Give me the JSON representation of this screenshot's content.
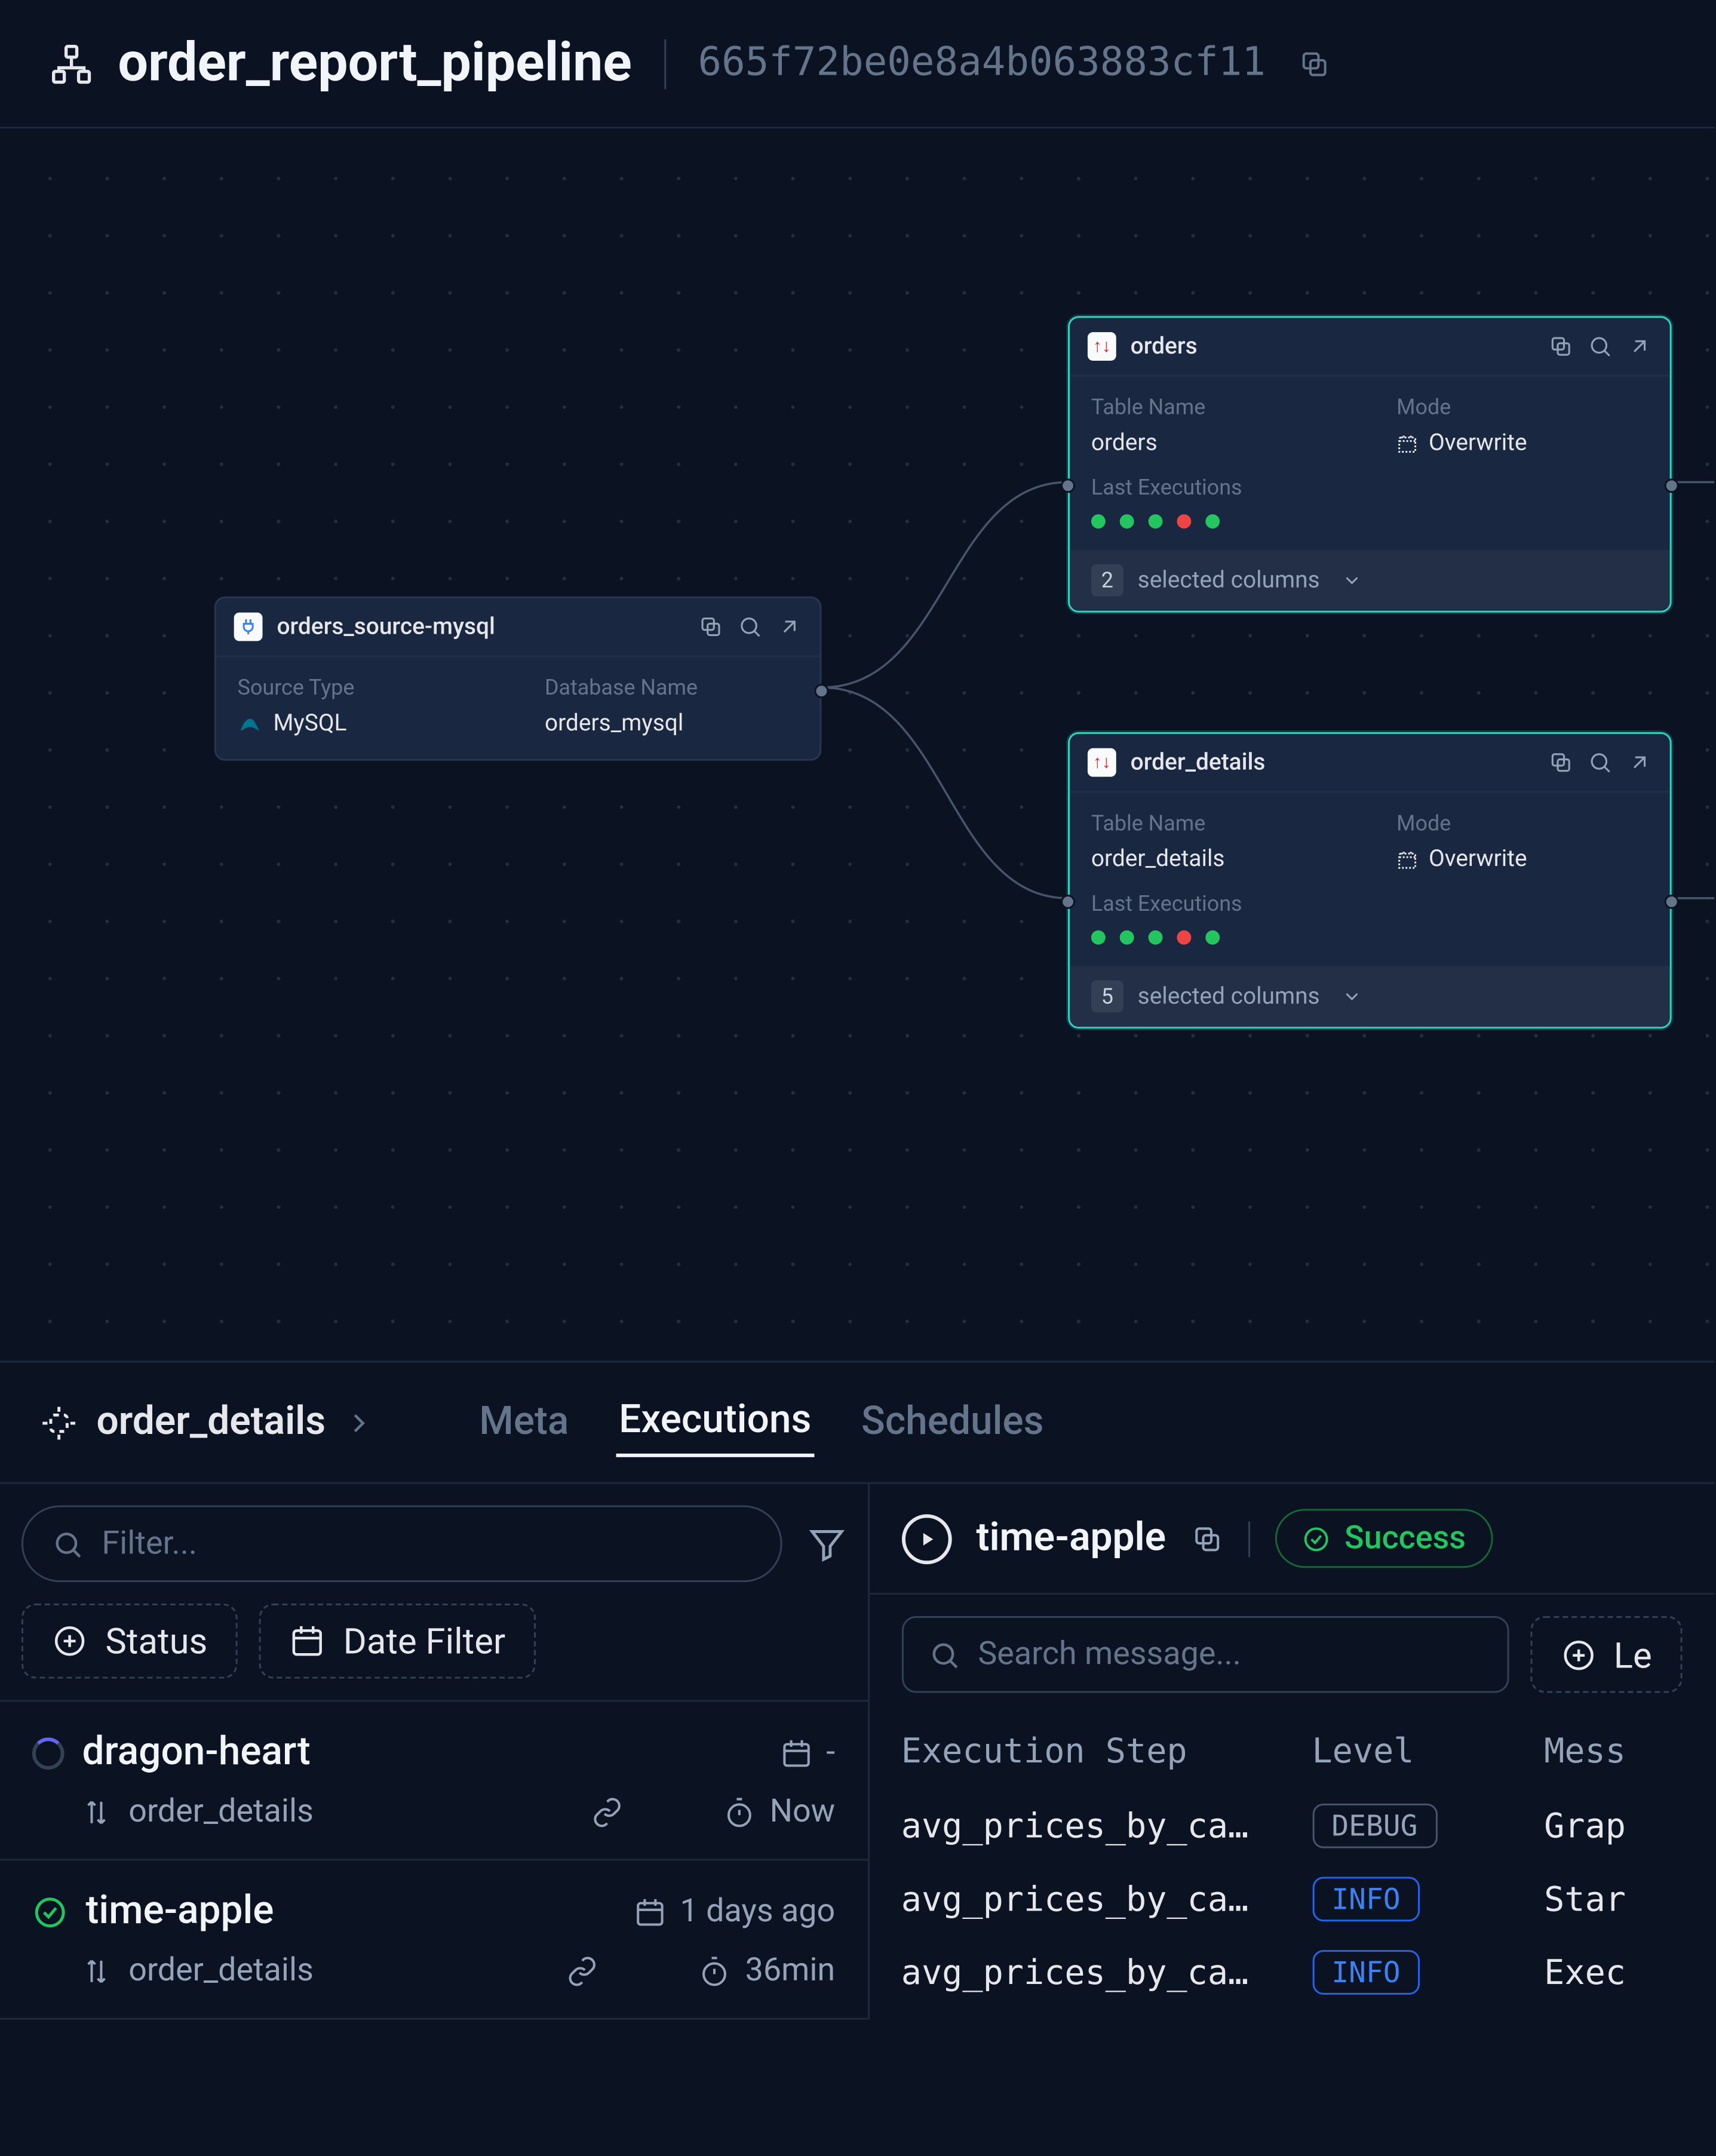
{
  "header": {
    "title": "order_report_pipeline",
    "hash": "665f72be0e8a4b063883cf11"
  },
  "nodes": {
    "source": {
      "title": "orders_source-mysql",
      "source_type_label": "Source Type",
      "source_type": "MySQL",
      "db_name_label": "Database Name",
      "db_name": "orders_mysql"
    },
    "orders": {
      "title": "orders",
      "table_name_label": "Table Name",
      "table_name": "orders",
      "mode_label": "Mode",
      "mode": "Overwrite",
      "last_exec_label": "Last Executions",
      "exec_statuses": [
        "green",
        "green",
        "green",
        "red",
        "green"
      ],
      "selected_count": "2",
      "selected_label": "selected columns"
    },
    "order_details": {
      "title": "order_details",
      "table_name_label": "Table Name",
      "table_name": "order_details",
      "mode_label": "Mode",
      "mode": "Overwrite",
      "last_exec_label": "Last Executions",
      "exec_statuses": [
        "green",
        "green",
        "green",
        "red",
        "green"
      ],
      "selected_count": "5",
      "selected_label": "selected columns"
    }
  },
  "panel": {
    "crumb": "order_details",
    "tabs": {
      "meta": "Meta",
      "executions": "Executions",
      "schedules": "Schedules"
    },
    "filter_placeholder": "Filter...",
    "status_chip": "Status",
    "date_chip": "Date Filter",
    "executions_list": [
      {
        "status": "running",
        "name": "dragon-heart",
        "subject": "order_details",
        "date": "-",
        "duration": "Now"
      },
      {
        "status": "success",
        "name": "time-apple",
        "subject": "order_details",
        "date": "1 days ago",
        "duration": "36min"
      }
    ],
    "right": {
      "title": "time-apple",
      "status": "Success",
      "search_placeholder": "Search message...",
      "level_chip": "Le",
      "table_headers": {
        "step": "Execution Step",
        "level": "Level",
        "msg": "Mess"
      },
      "rows": [
        {
          "step": "avg_prices_by_ca…",
          "level": "DEBUG",
          "msg": "Grap"
        },
        {
          "step": "avg_prices_by_ca…",
          "level": "INFO",
          "msg": "Star"
        },
        {
          "step": "avg_prices_by_ca…",
          "level": "INFO",
          "msg": "Exec"
        }
      ]
    }
  }
}
